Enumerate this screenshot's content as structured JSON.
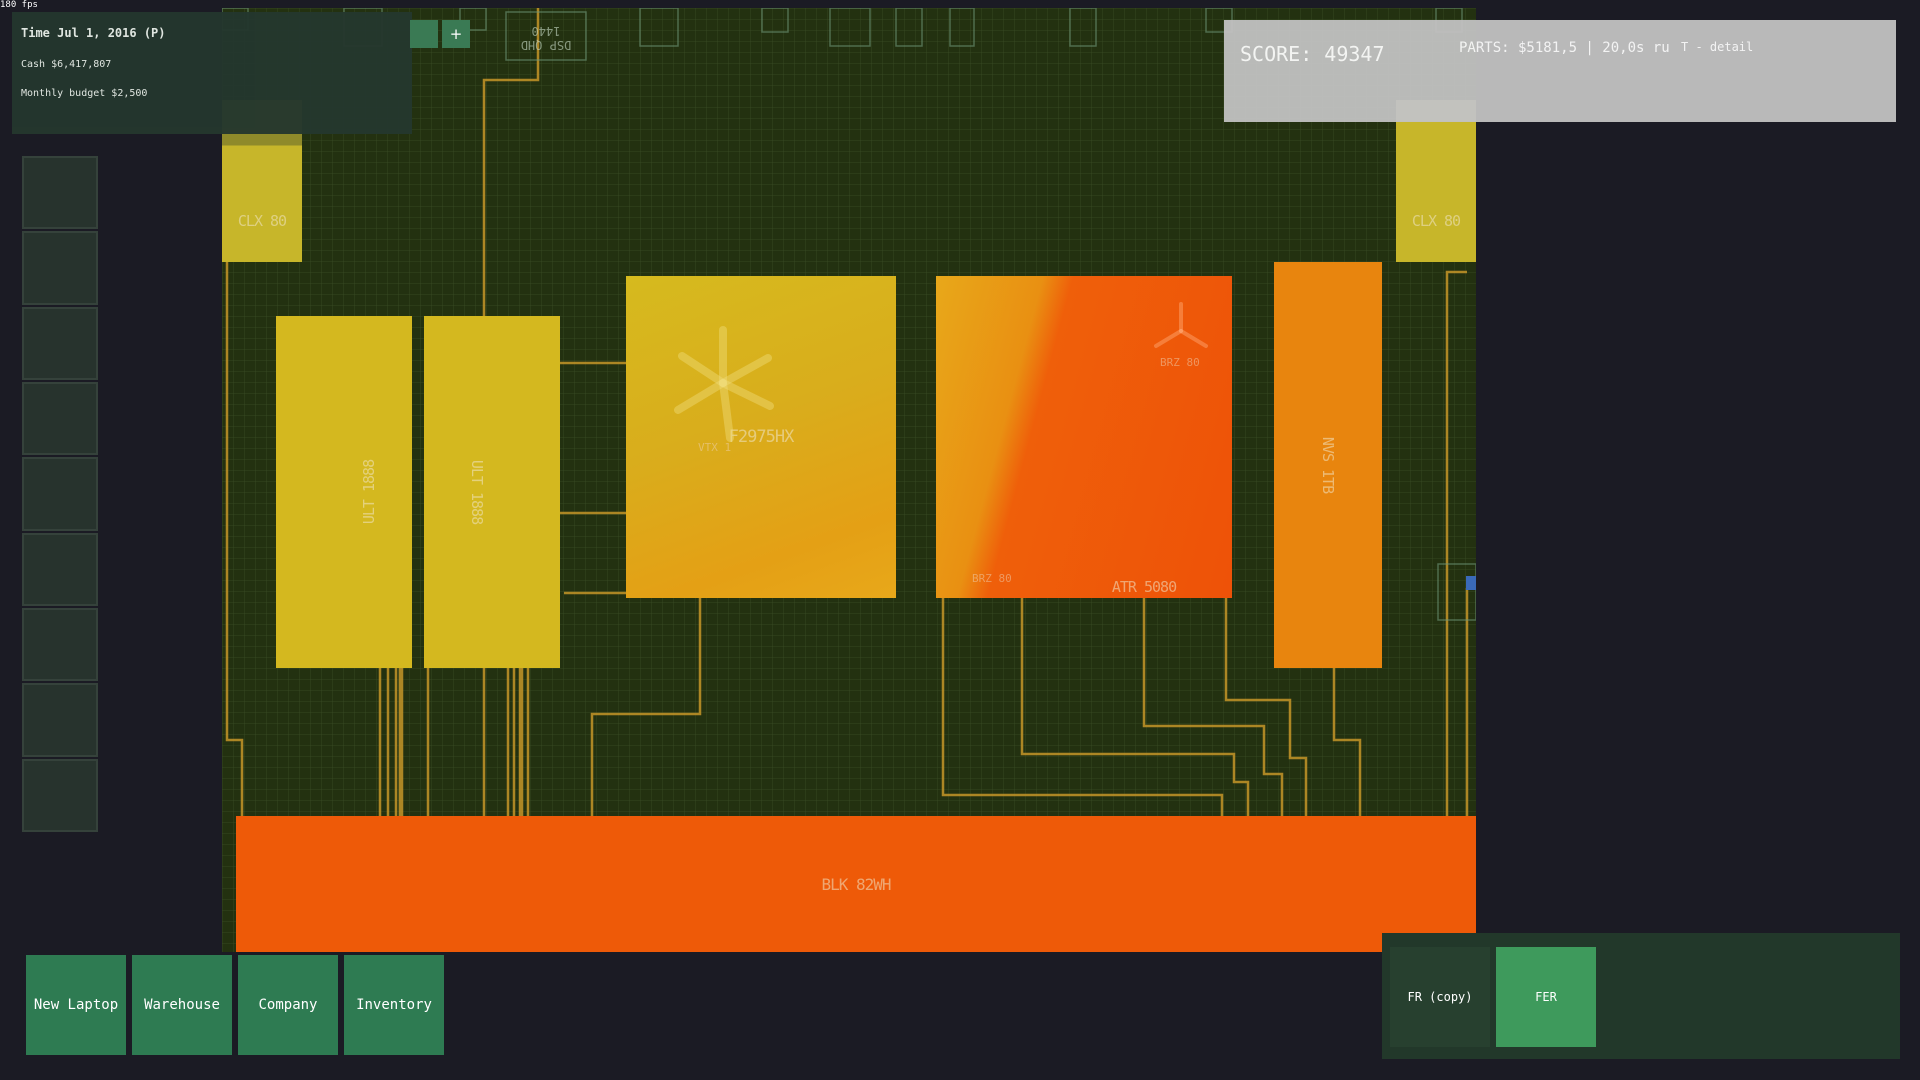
{
  "fps": "180 fps",
  "hud": {
    "time": "Time Jul 1, 2016 (P)",
    "cash": "Cash $6,417,807",
    "budget": "Monthly budget $2,500",
    "plus_label": "+"
  },
  "score_panel": {
    "score": "SCORE: 49347",
    "parts": "PARTS: $5181,5 | 20,0s ru",
    "detail": "T - detail"
  },
  "components": {
    "clx_left": "CLX 80",
    "clx_right": "CLX 80",
    "ult": "ULT 1888",
    "ram2": "ULT 1888",
    "cpu": "F2975HX",
    "cpu_sub": "VTX 1",
    "gpu": "ATR 5080",
    "gpu_sub1": "BRZ 80",
    "gpu_sub2": "BRZ 80",
    "ssd": "NVS 1TB",
    "battery": "BLK 82WH",
    "display": "DSP QHD 1440"
  },
  "nav": [
    "New Laptop",
    "Warehouse",
    "Company",
    "Inventory"
  ],
  "designs": [
    "FR (copy)",
    "FER"
  ],
  "colors": {
    "board": "#233110",
    "trace": "#c59528",
    "yellow": "#d4b81f",
    "orange": "#e88b10",
    "red_orange": "#ee5a08",
    "nav_green": "#2e7b52"
  }
}
